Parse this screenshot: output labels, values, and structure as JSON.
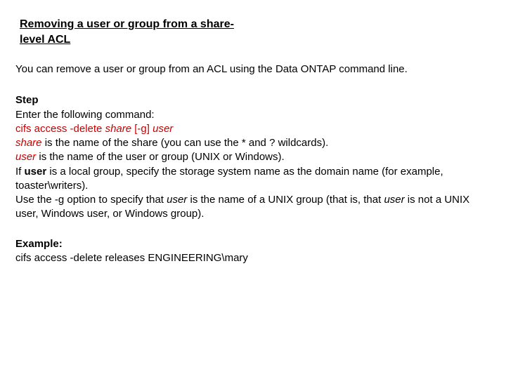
{
  "title": "Removing a user or group from a share-level ACL",
  "intro": "You can remove a user or group from an ACL using the Data ONTAP command line.",
  "step_label": "Step",
  "enter_line": "Enter the following command:",
  "cmd": {
    "prefix": "cifs access -delete ",
    "share": "share",
    "mid": " [-g] ",
    "user": "user"
  },
  "share_line_a": "share",
  "share_line_b": " is the name of the share (you can use the * and ? wildcards).",
  "user_line_a": "user",
  "user_line_b": " is the name of the user or group (UNIX or Windows).",
  "if_line_a": "If ",
  "if_line_b": "user",
  "if_line_c": " is a local group, specify the storage system name as the domain name (for example, toaster\\writers).",
  "g_line_a": "Use the -g option to specify that ",
  "g_line_b": "user",
  "g_line_c": " is the name of a UNIX group (that is, that ",
  "g_line_d": "user",
  "g_line_e": " is not a UNIX user, Windows user, or Windows group).",
  "example_label": "Example:",
  "example_cmd": "cifs access -delete releases ENGINEERING\\mary"
}
